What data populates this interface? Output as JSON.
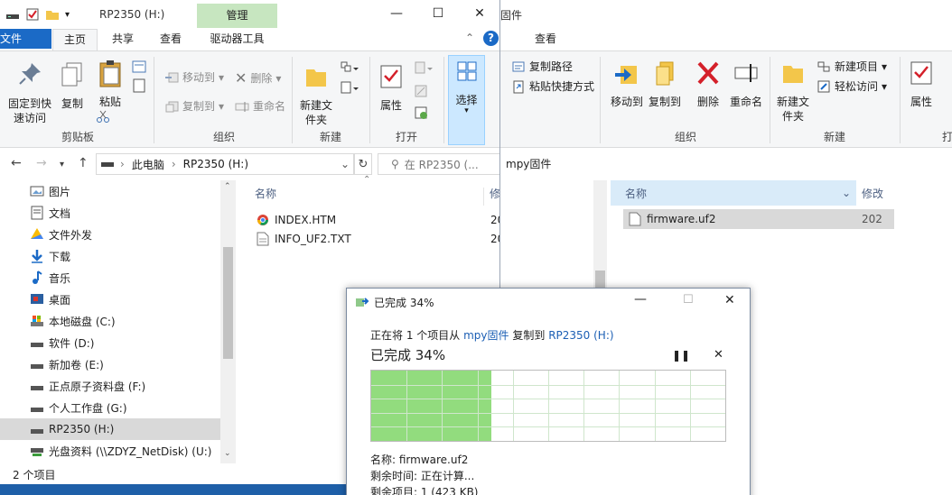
{
  "left": {
    "title": "RP2350 (H:)",
    "context_tab": "管理",
    "tabs": [
      "文件",
      "主页",
      "共享",
      "查看",
      "驱动器工具"
    ],
    "clipboard": {
      "pin": "固定到快速访问",
      "copy": "复制",
      "paste": "粘贴",
      "label": "剪贴板"
    },
    "organize": {
      "move_to": "移动到",
      "copy_to": "复制到",
      "delete": "删除",
      "rename": "重命名",
      "label": "组织"
    },
    "new": {
      "new_folder": "新建文件夹",
      "label": "新建"
    },
    "open": {
      "properties": "属性",
      "label": "打开"
    },
    "select": {
      "select": "选择"
    },
    "address": {
      "root": "此电脑",
      "drive": "RP2350 (H:)",
      "search_placeholder": "在 RP2350 (..."
    },
    "tree": [
      "图片",
      "文档",
      "文件外发",
      "下载",
      "音乐",
      "桌面",
      "本地磁盘 (C:)",
      "软件 (D:)",
      "新加卷 (E:)",
      "正点原子资料盘 (F:)",
      "个人工作盘 (G:)",
      "RP2350 (H:)",
      "光盘资料 (\\\\ZDYZ_NetDisk) (U:)"
    ],
    "col_name": "名称",
    "col_mod": "修",
    "files": [
      {
        "name": "INDEX.HTM",
        "date": "20"
      },
      {
        "name": "INFO_UF2.TXT",
        "date": "20"
      }
    ],
    "status": "2 个项目"
  },
  "right": {
    "title": "固件",
    "tab_view": "查看",
    "copy_path": "复制路径",
    "paste_shortcut": "粘贴快捷方式",
    "move_to": "移动到",
    "copy_to": "复制到",
    "delete": "删除",
    "rename": "重命名",
    "org_label": "组织",
    "new_folder": "新建文件夹",
    "new_item": "新建项目",
    "easy_access": "轻松访问",
    "new_label": "新建",
    "properties": "属性",
    "open_partial": "打",
    "address": "mpy固件",
    "col_name": "名称",
    "col_mod": "修改",
    "file": {
      "name": "firmware.uf2",
      "date": "202"
    }
  },
  "dialog": {
    "title": "已完成 34%",
    "line_prefix": "正在将 1 个项目从",
    "src": "mpy固件",
    "mid": "复制到",
    "dst": "RP2350 (H:)",
    "big": "已完成 34%",
    "progress": 0.34,
    "name_label": "名称: firmware.uf2",
    "remain_time": "剩余时间: 正在计算...",
    "remain_items": "剩余项目: 1 (423 KB)"
  }
}
